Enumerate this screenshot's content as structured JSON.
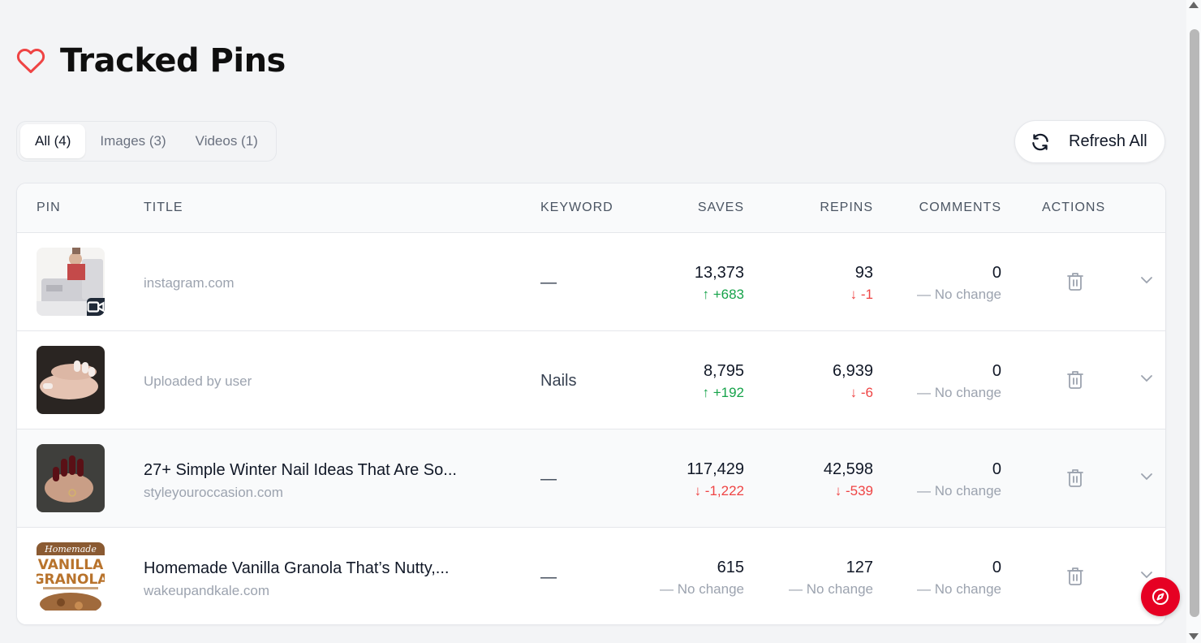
{
  "header": {
    "title": "Tracked Pins",
    "icon": "heart-icon",
    "accent": "#ef4444"
  },
  "tabs": [
    {
      "label": "All (4)",
      "active": true
    },
    {
      "label": "Images (3)",
      "active": false
    },
    {
      "label": "Videos (1)",
      "active": false
    }
  ],
  "refresh": {
    "label": "Refresh All",
    "icon": "refresh-icon"
  },
  "columns": [
    "PIN",
    "TITLE",
    "KEYWORD",
    "SAVES",
    "REPINS",
    "COMMENTS",
    "ACTIONS"
  ],
  "rows": [
    {
      "title": "",
      "source": "instagram.com",
      "keyword": "—",
      "is_video": true,
      "saves": "13,373",
      "saves_delta": "+683",
      "saves_dir": "up",
      "repins": "93",
      "repins_delta": "-1",
      "repins_dir": "down",
      "comments": "0",
      "comments_delta": "No change",
      "comments_dir": "flat"
    },
    {
      "title": "",
      "source": "Uploaded by user",
      "keyword": "Nails",
      "is_video": false,
      "saves": "8,795",
      "saves_delta": "+192",
      "saves_dir": "up",
      "repins": "6,939",
      "repins_delta": "-6",
      "repins_dir": "down",
      "comments": "0",
      "comments_delta": "No change",
      "comments_dir": "flat"
    },
    {
      "title": "27+ Simple Winter Nail Ideas That Are So...",
      "source": "styleyouroccasion.com",
      "keyword": "—",
      "is_video": false,
      "saves": "117,429",
      "saves_delta": "-1,222",
      "saves_dir": "down",
      "repins": "42,598",
      "repins_delta": "-539",
      "repins_dir": "down",
      "comments": "0",
      "comments_delta": "No change",
      "comments_dir": "flat"
    },
    {
      "title": "Homemade Vanilla Granola That’s Nutty,...",
      "source": "wakeupandkale.com",
      "keyword": "—",
      "is_video": false,
      "saves": "615",
      "saves_delta": "No change",
      "saves_dir": "flat",
      "repins": "127",
      "repins_delta": "No change",
      "repins_dir": "flat",
      "comments": "0",
      "comments_delta": "No change",
      "comments_dir": "flat"
    }
  ],
  "thumb_texts": {
    "granola_line1": "Homemade",
    "granola_line2": "VANILLA",
    "granola_line3": "GRANOLA"
  },
  "colors": {
    "up": "#16a34a",
    "down": "#ef4444",
    "flat": "#9ca3af",
    "fab": "#e60023"
  }
}
